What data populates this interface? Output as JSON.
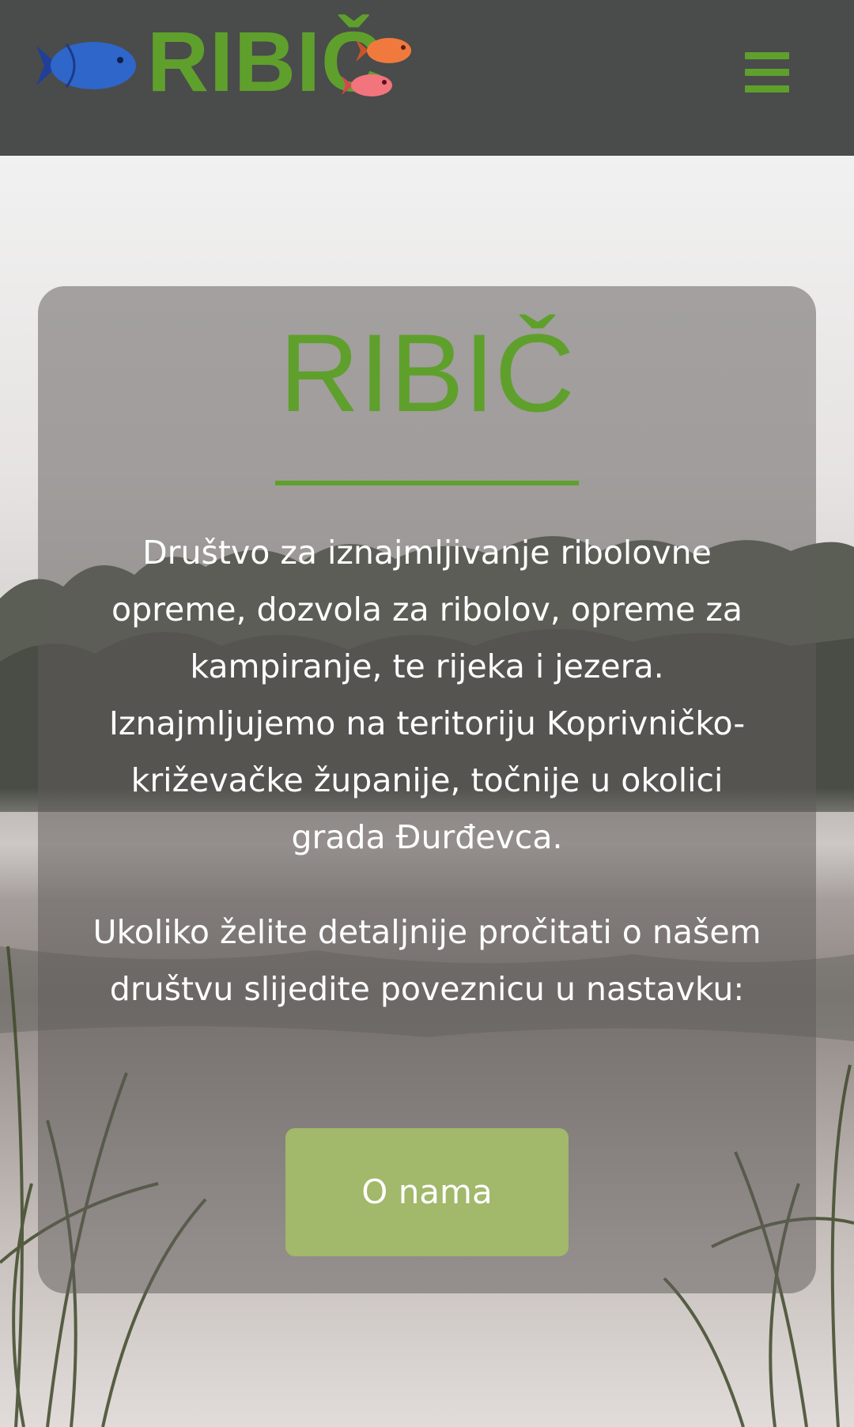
{
  "header": {
    "logo_text": "RIBIČ",
    "menu_icon": "hamburger-menu-icon",
    "fish_icons": [
      "blue-fish-icon",
      "orange-fish-icon",
      "pink-fish-icon"
    ]
  },
  "hero": {
    "background_image": "misty-lake-with-reeds",
    "title": "RIBIČ",
    "paragraph_1": "Društvo za iznajmljivanje ribolovne opreme, dozvola za ribolov, opreme za kampiranje, te rijeka i jezera. Iznajmljujemo na teritoriju Koprivničko-križevačke županije, točnije u okolici grada Đurđevca.",
    "paragraph_2": "Ukoliko želite detaljnije pročitati o našem društvu slijedite poveznicu u nastavku:",
    "button_label": "O nama"
  },
  "colors": {
    "header_bg": "#4a4b4b",
    "brand_green": "#5fa02c",
    "button_bg": "#a2b86a",
    "text_white": "#ffffff"
  }
}
